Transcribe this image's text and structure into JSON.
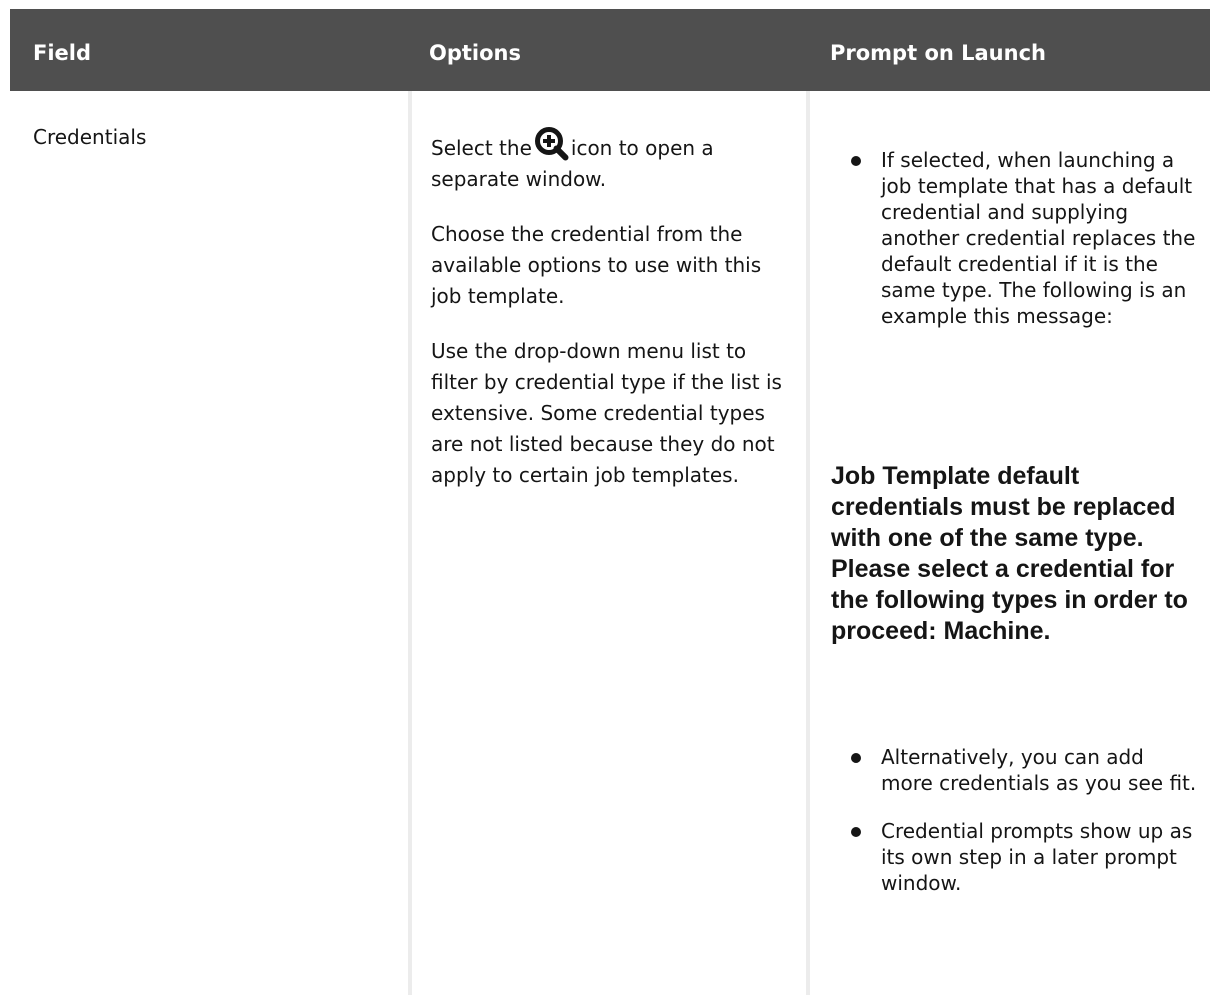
{
  "table": {
    "headers": {
      "field": "Field",
      "options": "Options",
      "prompt": "Prompt on Launch"
    },
    "row": {
      "field": "Credentials",
      "options": {
        "select_prefix": "Select the",
        "select_icon": "search-plus-icon",
        "select_suffix": "icon to open a separate window.",
        "choose": "Choose the credential from the available options to use with this job template.",
        "dropdown": "Use the drop-down menu list to filter by credential type if the list is extensive. Some credential types are not listed because they do not apply to certain job templates."
      },
      "prompt": {
        "bullet_1": "If selected, when launching a job template that has a default credential and supplying another credential replaces the default credential if it is the same type. The following is an example this message:",
        "message": "Job Template default credentials must be replaced with one of the same type. Please select a credential for the following types in order to proceed: Machine.",
        "bullet_2": "Alternatively, you can add more credentials as you see fit.",
        "bullet_3": "Credential prompts show up as its own step in a later prompt window."
      }
    }
  },
  "colors": {
    "header_bg": "#4f4f4f",
    "header_text": "#ffffff",
    "divider": "#ececec",
    "text": "#151515"
  }
}
